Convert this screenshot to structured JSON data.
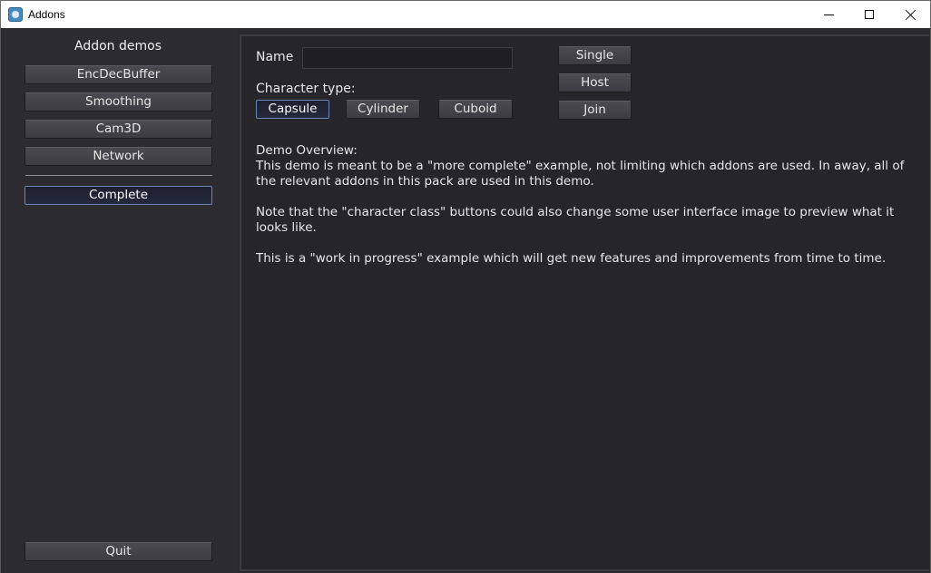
{
  "window": {
    "title": "Addons",
    "controls": [
      "minimize-icon",
      "maximize-icon",
      "close-icon"
    ]
  },
  "sidebar": {
    "title": "Addon demos",
    "items": [
      {
        "label": "EncDecBuffer"
      },
      {
        "label": "Smoothing"
      },
      {
        "label": "Cam3D"
      },
      {
        "label": "Network"
      },
      {
        "label": "Complete",
        "selected": true
      }
    ],
    "quit_label": "Quit"
  },
  "main": {
    "name_label": "Name",
    "name_value": "",
    "character_type_label": "Character type:",
    "character_types": [
      {
        "label": "Capsule",
        "selected": true
      },
      {
        "label": "Cylinder"
      },
      {
        "label": "Cuboid"
      }
    ],
    "mode_buttons": [
      {
        "label": "Single"
      },
      {
        "label": "Host"
      },
      {
        "label": "Join"
      }
    ],
    "overview": {
      "heading": "Demo Overview:",
      "para1": "This demo is meant to be a \"more complete\" example, not limiting which addons are used. In away, all of the relevant addons in this pack are used in this demo.",
      "para2": "Note that the \"character class\" buttons could also change some user interface image to preview what it looks like.",
      "para3": "This is a \"work in progress\" example which will get new features and improvements from time to time."
    }
  },
  "colors": {
    "background": "#2a2a2e",
    "panel": "#25252a",
    "button": "#424248",
    "selected_border": "#6a86b8",
    "text": "#e0e0e0"
  }
}
